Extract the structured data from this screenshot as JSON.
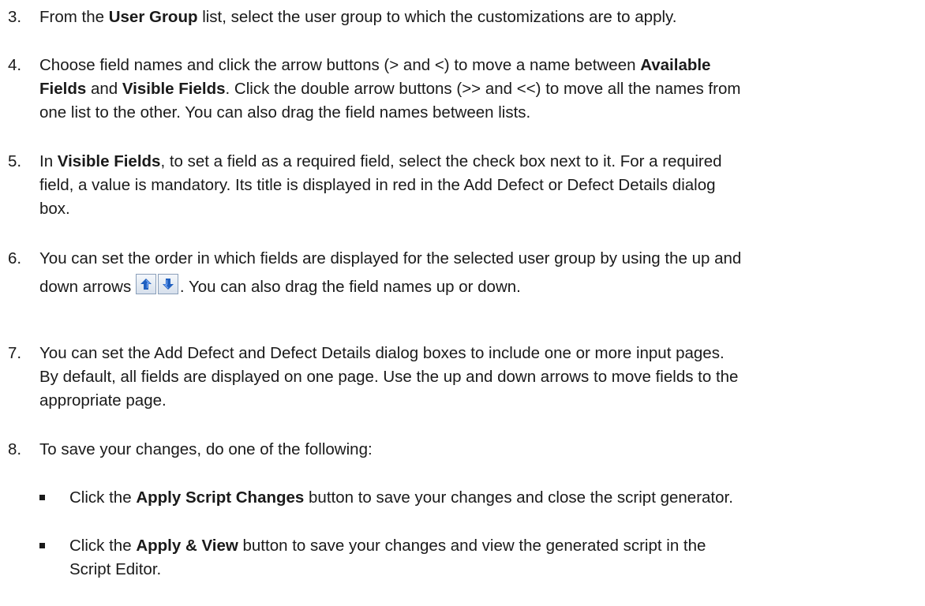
{
  "steps": [
    {
      "num": "3.",
      "parts": [
        "From the ",
        "User Group",
        " list, select the user group to which the customizations are to apply."
      ]
    },
    {
      "num": "4.",
      "line1": [
        "Choose field names and click the arrow buttons (> and <) to move a name between ",
        "Available"
      ],
      "line2": [
        "Fields",
        " and ",
        "Visible Fields",
        ". Click the double arrow buttons (>> and <<) to move all the names from"
      ],
      "line3": "one list to the other. You can also drag the field names between lists."
    },
    {
      "num": "5.",
      "line1": [
        "In ",
        "Visible Fields",
        ", to set a field as a required field, select the check box next to it. For a required"
      ],
      "line2": "field, a value is mandatory. Its title is displayed in red in the Add Defect or Defect Details dialog",
      "line3": "box."
    },
    {
      "num": "6.",
      "line1": "You can set the order in which fields are displayed for the selected user group by using the up and",
      "line2_before": "down arrows",
      "line2_after": ". You can also drag the field names up or down."
    },
    {
      "num": "7.",
      "line1": "You can set the Add Defect and Defect Details dialog boxes to include one or more input pages.",
      "line2": "By default, all fields are displayed on one page. Use the up and down arrows to move fields to the",
      "line3": "appropriate page."
    },
    {
      "num": "8.",
      "text": "To save your changes, do one of the following:"
    }
  ],
  "sub_items": [
    {
      "parts": [
        "Click the ",
        "Apply Script Changes",
        " button to save your changes and close the script generator."
      ]
    },
    {
      "line1": [
        "Click the ",
        "Apply & View",
        " button to save your changes and view the generated script in the"
      ],
      "line2": "Script Editor."
    }
  ],
  "icons": {
    "up": "move-up-arrow",
    "down": "move-down-arrow",
    "arrow_color": "#1f5fbf"
  }
}
